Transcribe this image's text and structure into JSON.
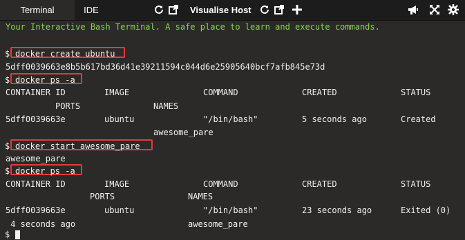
{
  "tabs": {
    "terminal": "Terminal",
    "ide": "IDE"
  },
  "toolbar": {
    "visualise_host": "Visualise Host"
  },
  "icons": [
    "refresh-icon",
    "external-link-icon",
    "plus-icon",
    "megaphone-icon",
    "fullscreen-icon",
    "settings-icon"
  ],
  "terminal": {
    "welcome": "Your Interactive Bash Terminal. A safe place to learn and execute commands.",
    "prompt": "$",
    "cmd1": "docker create ubuntu",
    "out1": "5dff0039663e8b5b617bd36d41e39211594c044d6e25905640bcf7afb845e73d",
    "cmd2": "docker ps -a",
    "table1": {
      "headers": [
        "CONTAINER ID",
        "IMAGE",
        "COMMAND",
        "CREATED",
        "STATUS"
      ],
      "headers2": [
        "PORTS",
        "NAMES"
      ],
      "row": [
        "5dff0039663e",
        "ubuntu",
        "\"/bin/bash\"",
        "5 seconds ago",
        "Created"
      ],
      "row_name": "awesome_pare"
    },
    "cmd3": "docker start awesome_pare",
    "out3": "awesome_pare",
    "cmd4": "docker ps -a",
    "table2": {
      "headers": [
        "CONTAINER ID",
        "IMAGE",
        "COMMAND",
        "CREATED",
        "STATUS"
      ],
      "headers2": [
        "PORTS",
        "NAMES"
      ],
      "row": [
        "5dff0039663e",
        "ubuntu",
        "\"/bin/bash\"",
        "23 seconds ago",
        "Exited (0)"
      ],
      "row_status_cont": " 4 seconds ago",
      "row_name": "awesome_pare"
    }
  },
  "colors": {
    "background": "#2b2a28",
    "topbar": "#1c1c1c",
    "welcome": "#8bd44a",
    "highlight": "#e03c3c"
  }
}
